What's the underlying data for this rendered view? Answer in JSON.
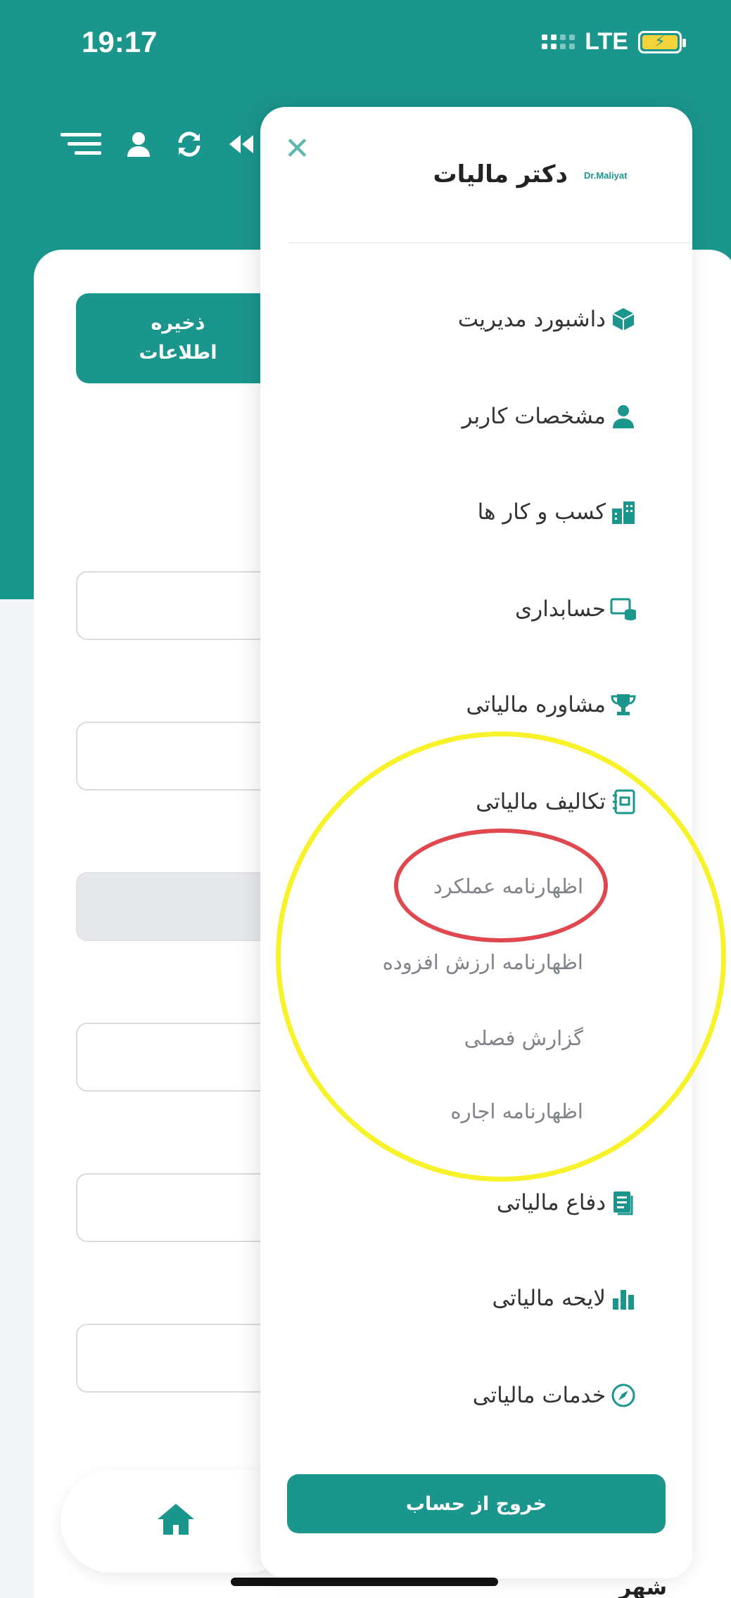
{
  "status_bar": {
    "time": "19:17",
    "network": "LTE"
  },
  "header": {
    "icons": [
      "menu-icon",
      "user-icon",
      "refresh-icon",
      "double-chevron-icon"
    ]
  },
  "background_form": {
    "save_button": "ذخیره\nاطلاعات",
    "partial_label": "شهر"
  },
  "drawer": {
    "brand_logo": "Dr.Maliyat",
    "brand_name": "دکتر مالیات",
    "menu": [
      {
        "label": "داشبورد مدیریت",
        "icon": "cube-icon"
      },
      {
        "label": "مشخصات کاربر",
        "icon": "user-icon"
      },
      {
        "label": "کسب و کار ها",
        "icon": "building-icon"
      },
      {
        "label": "حسابداری",
        "icon": "accounting-icon"
      },
      {
        "label": "مشاوره مالیاتی",
        "icon": "trophy-icon"
      },
      {
        "label": "تکالیف مالیاتی",
        "icon": "notebook-icon"
      },
      {
        "label": "دفاع مالیاتی",
        "icon": "document-icon"
      },
      {
        "label": "لایحه مالیاتی",
        "icon": "bar-chart-icon"
      },
      {
        "label": "خدمات مالیاتی",
        "icon": "compass-icon"
      }
    ],
    "submenu": [
      "اظهارنامه عملکرد",
      "اظهارنامه ارزش افزوده",
      "گزارش فصلی",
      "اظهارنامه اجاره"
    ],
    "logout": "خروج از حساب"
  },
  "colors": {
    "primary": "#1b968d",
    "highlight_yellow": "#f7f22a",
    "highlight_red": "#e0474f"
  }
}
